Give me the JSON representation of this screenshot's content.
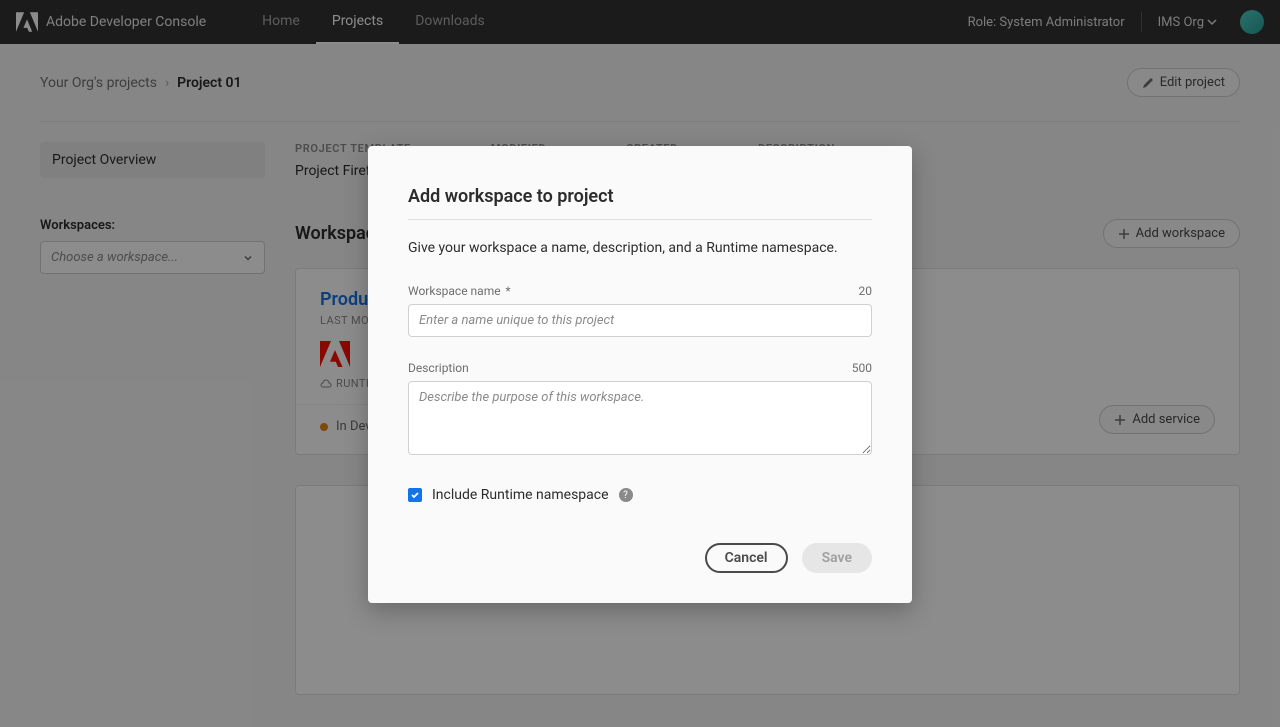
{
  "nav": {
    "brand": "Adobe Developer Console",
    "links": [
      "Home",
      "Projects",
      "Downloads"
    ],
    "active_index": 1,
    "role": "Role: System Administrator",
    "org": "IMS Org"
  },
  "breadcrumb": {
    "parent": "Your Org's projects",
    "current": "Project 01"
  },
  "edit_project_label": "Edit project",
  "sidebar": {
    "overview": "Project Overview",
    "workspaces_label": "Workspaces:",
    "choose_placeholder": "Choose a workspace..."
  },
  "meta": {
    "template_label": "PROJECT TEMPLATE",
    "template_value": "Project Firefly",
    "modified_label": "MODIFIED",
    "created_label": "CREATED",
    "description_label": "DESCRIPTION"
  },
  "workspaces": {
    "title": "Workspaces",
    "add_label": "Add workspace",
    "card": {
      "title": "Production",
      "last_modified_prefix": "LAST MODIFI",
      "runtime": "RUNTIME",
      "status": "In Devel",
      "add_service": "Add service"
    }
  },
  "modal": {
    "title": "Add workspace to project",
    "intro": "Give your workspace a name, description, and a Runtime namespace.",
    "name_label": "Workspace name",
    "name_count": "20",
    "name_placeholder": "Enter a name unique to this project",
    "desc_label": "Description",
    "desc_count": "500",
    "desc_placeholder": "Describe the purpose of this workspace.",
    "include_runtime": "Include Runtime namespace",
    "cancel": "Cancel",
    "save": "Save"
  }
}
